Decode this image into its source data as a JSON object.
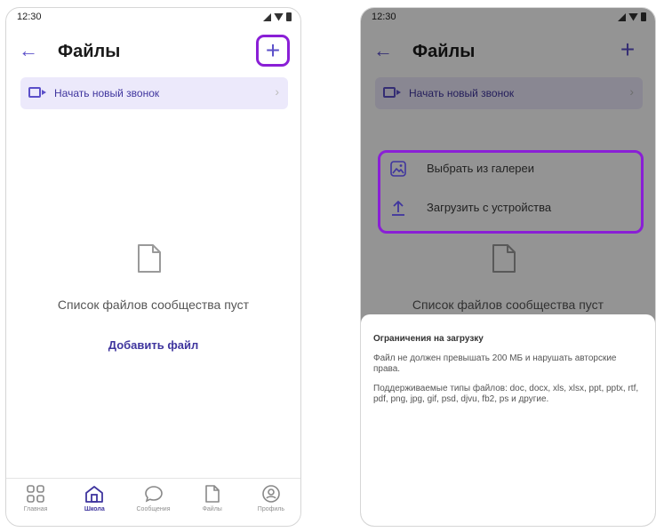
{
  "left": {
    "status": {
      "time": "12:30"
    },
    "header": {
      "title": "Файлы",
      "back_glyph": "←",
      "add_glyph": "+"
    },
    "callbar": {
      "label": "Начать новый звонок",
      "chevron": "›"
    },
    "empty": {
      "message": "Список файлов сообщества пуст",
      "add_link": "Добавить файл"
    },
    "nav": [
      {
        "label": "Главная",
        "icon": "grid-icon",
        "active": false
      },
      {
        "label": "Школа",
        "icon": "school-icon",
        "active": true
      },
      {
        "label": "Сообщения",
        "icon": "chat-bubble-icon",
        "active": false
      },
      {
        "label": "Файлы",
        "icon": "file-icon",
        "active": false
      },
      {
        "label": "Профиль",
        "icon": "profile-icon",
        "active": false
      }
    ]
  },
  "right": {
    "status": {
      "time": "12:30"
    },
    "header": {
      "title": "Файлы",
      "back_glyph": "←",
      "add_glyph": "+"
    },
    "callbar": {
      "label": "Начать новый звонок",
      "chevron": "›"
    },
    "empty": {
      "message": "Список файлов сообщества пуст"
    },
    "sheet": {
      "title": "Ограничения на загрузку",
      "p1": "Файл не должен превышать 200 МБ и нарушать авторские права.",
      "p2": "Поддерживаемые типы файлов: doc, docx, xls, xlsx, ppt, pptx, rtf, pdf, png, jpg, gif, psd, djvu, fb2, ps и другие.",
      "actions": [
        {
          "label": "Выбрать из галереи",
          "icon": "gallery-icon"
        },
        {
          "label": "Загрузить с устройства",
          "icon": "upload-icon"
        }
      ]
    }
  },
  "colors": {
    "accent": "#5b4fc9",
    "highlight": "#8a1fd6",
    "callbar_bg": "#ece9fb"
  }
}
